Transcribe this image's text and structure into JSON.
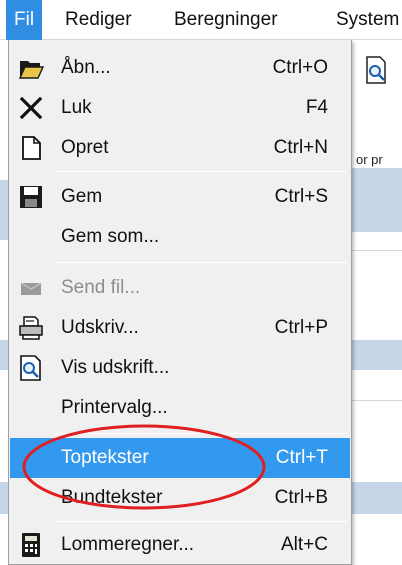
{
  "menubar": {
    "items": [
      {
        "label": "Fil"
      },
      {
        "label": "Rediger"
      },
      {
        "label": "Beregninger"
      },
      {
        "label": "System"
      }
    ]
  },
  "background": {
    "clipped_text": "or pr"
  },
  "file_menu": {
    "items": [
      {
        "label": "Åbn...",
        "shortcut": "Ctrl+O",
        "icon": "open-folder-icon"
      },
      {
        "label": "Luk",
        "shortcut": "F4",
        "icon": "close-x-icon"
      },
      {
        "label": "Opret",
        "shortcut": "Ctrl+N",
        "icon": "new-document-icon"
      },
      {
        "label": "Gem",
        "shortcut": "Ctrl+S",
        "icon": "floppy-disk-icon"
      },
      {
        "label": "Gem som...",
        "shortcut": ""
      },
      {
        "label": "Send fil...",
        "shortcut": "",
        "icon": "send-file-icon",
        "disabled": true
      },
      {
        "label": "Udskriv...",
        "shortcut": "Ctrl+P",
        "icon": "printer-icon"
      },
      {
        "label": "Vis udskrift...",
        "shortcut": "",
        "icon": "print-preview-icon"
      },
      {
        "label": "Printervalg...",
        "shortcut": ""
      },
      {
        "label": "Toptekster",
        "shortcut": "Ctrl+T",
        "highlighted": true
      },
      {
        "label": "Bundtekster",
        "shortcut": "Ctrl+B"
      },
      {
        "label": "Lommeregner...",
        "shortcut": "Alt+C",
        "icon": "calculator-icon"
      }
    ]
  },
  "colors": {
    "menubar_active": "#2f8ee3",
    "menu_highlight": "#3399ee",
    "annotation": "#e02020"
  }
}
